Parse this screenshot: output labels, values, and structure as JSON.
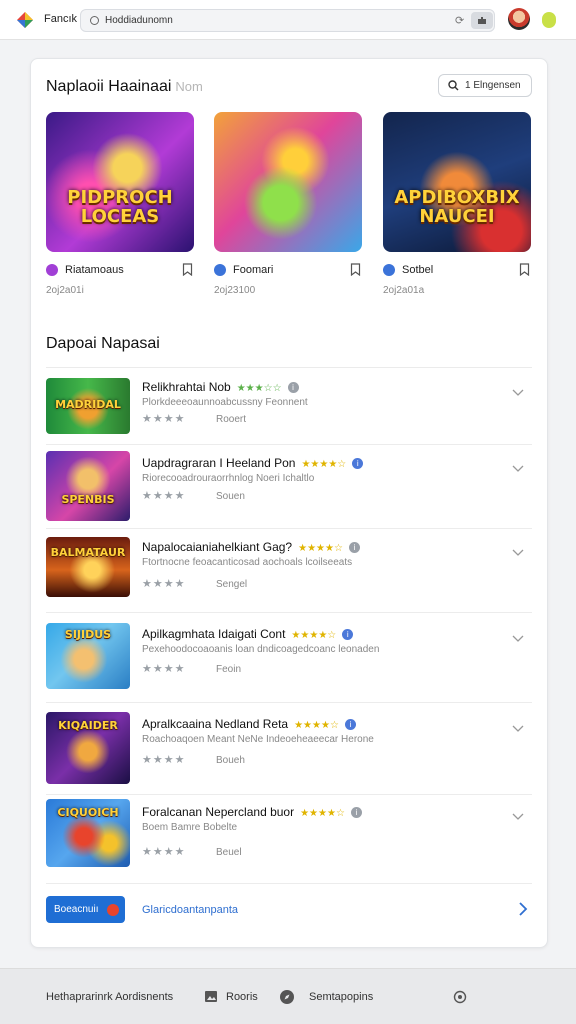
{
  "header": {
    "app_name": "Fancık",
    "url": "Hoddiadunomn"
  },
  "featured": {
    "title": "Naplaoii Haainaai",
    "title_hint": "Nom",
    "search_label": "1 Elngensen",
    "items": [
      {
        "thumb_text": "PIDPROCH LOCEAS",
        "name": "Riatamoaus",
        "date": "2oj2a01i",
        "dot_color": "#a13fd6"
      },
      {
        "thumb_text": "",
        "name": "Foomari",
        "date": "2oj23100",
        "dot_color": "#3b73d9"
      },
      {
        "thumb_text": "APDIBOXBIX NAUCEI",
        "name": "Sotbel",
        "date": "2oj2a01a",
        "dot_color": "#3b73d9"
      }
    ]
  },
  "list": {
    "title": "Dapoai Napasai",
    "items": [
      {
        "thumb_text": "MADRIDAL",
        "title": "Relikhrahtai Nob",
        "stars": "★★★☆☆",
        "desc": "Plorkdeeeoaunnoabcussny Feonnent",
        "rating": "★★★★",
        "count": "Rooert"
      },
      {
        "thumb_text": "SPENBIS",
        "title": "Uapdragraran I Heeland Pon",
        "stars": "★★★★☆",
        "desc": "Riorecooadrouraorrhnlog Noeri Ichaltlo",
        "rating": "★★★★",
        "count": "Souen"
      },
      {
        "thumb_text": "BALMATAUR",
        "title": "Napalocaianiahelkiant Gag?",
        "stars": "★★★★☆",
        "desc": "Ftortnocne feoacanticosad aochoals lcoilseeats",
        "rating": "★★★★",
        "count": "Sengel"
      },
      {
        "thumb_text": "SIJIDUS",
        "title": "Apilkagmhata Idaigati Cont",
        "stars": "★★★★☆",
        "desc": "Pexehoodocoaoanis loan dndicoagedcoanc leonaden",
        "rating": "★★★★",
        "count": "Feoin"
      },
      {
        "thumb_text": "KIQAIDER",
        "title": "Apralkcaaina Nedland Reta",
        "stars": "★★★★☆",
        "desc": "Roachoaqoen Meant NeNe Indeoeheaeecar Herone",
        "rating": "★★★★",
        "count": "Boueh"
      },
      {
        "thumb_text": "CIQUOICH",
        "title": "Foralcanan Nepercland buor",
        "stars": "★★★★☆",
        "desc": "Boem Bamre Bobelte",
        "rating": "★★★★",
        "count": "Beuel"
      }
    ],
    "cta_label": "Boeacnuiı",
    "footer_link": "Glaricdoantanpanta"
  },
  "bottom_nav": {
    "left": "Hethaprarinrk Aordisnents",
    "middle": "Rooris",
    "right": "Semtapopins"
  },
  "colors": {
    "accent": "#1f6ed4",
    "link": "#2f6fd0"
  }
}
